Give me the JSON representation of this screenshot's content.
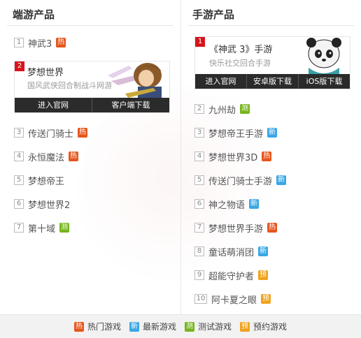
{
  "left": {
    "title": "端游产品",
    "featured": {
      "number": "2",
      "title": "梦想世界",
      "subtitle": "国风武侠回合制战斗网游",
      "buttons": [
        "进入官网",
        "客户端下载"
      ]
    },
    "items": [
      {
        "number": "1",
        "name": "神武3",
        "badge": "热",
        "badge_type": "hot"
      },
      {
        "number": "3",
        "name": "传送门骑士",
        "badge": "热",
        "badge_type": "hot"
      },
      {
        "number": "4",
        "name": "永恒魔法",
        "badge": "热",
        "badge_type": "hot"
      },
      {
        "number": "5",
        "name": "梦想帝王",
        "badge": "",
        "badge_type": ""
      },
      {
        "number": "6",
        "name": "梦想世界2",
        "badge": "",
        "badge_type": ""
      },
      {
        "number": "7",
        "name": "第十域",
        "badge": "测",
        "badge_type": "test"
      }
    ]
  },
  "right": {
    "title": "手游产品",
    "featured": {
      "number": "1",
      "title": "《神武 3》手游",
      "subtitle": "快乐社交回合手游",
      "buttons": [
        "进入官网",
        "安卓版下载",
        "iOS版下载"
      ]
    },
    "items": [
      {
        "number": "2",
        "name": "九州劫",
        "badge": "测",
        "badge_type": "test"
      },
      {
        "number": "3",
        "name": "梦想帝王手游",
        "badge": "新",
        "badge_type": "new"
      },
      {
        "number": "4",
        "name": "梦想世界3D",
        "badge": "热",
        "badge_type": "hot"
      },
      {
        "number": "5",
        "name": "传送门骑士手游",
        "badge": "新",
        "badge_type": "new"
      },
      {
        "number": "6",
        "name": "神之物语",
        "badge": "新",
        "badge_type": "new"
      },
      {
        "number": "7",
        "name": "梦想世界手游",
        "badge": "热",
        "badge_type": "hot"
      },
      {
        "number": "8",
        "name": "童话萌消团",
        "badge": "新",
        "badge_type": "new"
      },
      {
        "number": "9",
        "name": "超能守护者",
        "badge": "预",
        "badge_type": "book"
      },
      {
        "number": "10",
        "name": "阿卡夏之眼",
        "badge": "预",
        "badge_type": "book"
      }
    ]
  },
  "legend": [
    {
      "badge": "热",
      "badge_type": "hot",
      "label": "热门游戏"
    },
    {
      "badge": "新",
      "badge_type": "new",
      "label": "最新游戏"
    },
    {
      "badge": "测",
      "badge_type": "test",
      "label": "测试游戏"
    },
    {
      "badge": "预",
      "badge_type": "book",
      "label": "预约游戏"
    }
  ],
  "colors": {
    "hot": "#e6561d",
    "new": "#3aa7e6",
    "test": "#76b51c",
    "book": "#f0a21c",
    "rank_highlight": "#d7131b"
  }
}
